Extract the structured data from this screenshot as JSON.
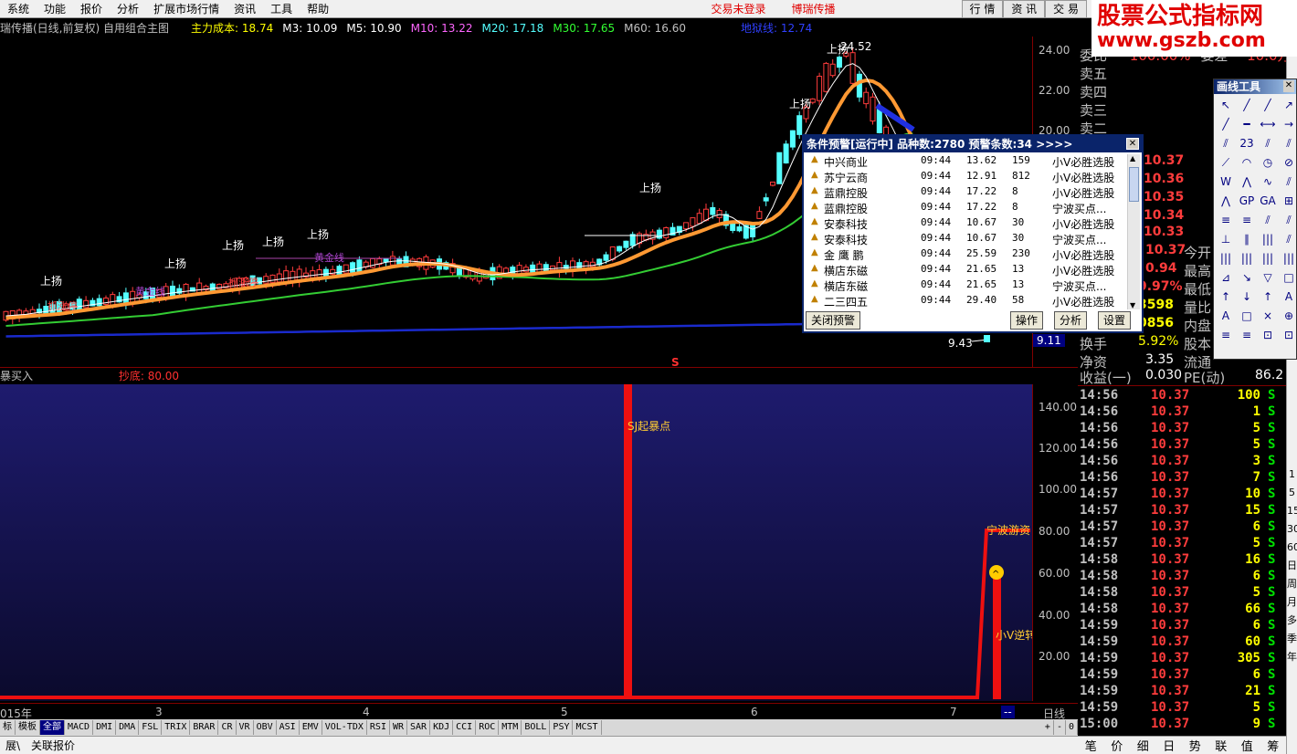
{
  "menu": {
    "items": [
      "系统",
      "功能",
      "报价",
      "分析",
      "扩展市场行情",
      "资讯",
      "工具",
      "帮助"
    ],
    "status_warn": "交易未登录",
    "status_brand": "博瑞传播",
    "right_tabs": [
      "行 情",
      "资 讯",
      "交 易"
    ]
  },
  "watermark": {
    "line1": "股票公式指标网",
    "line2": "www.gszb.com"
  },
  "chart_header": {
    "title": "瑞传播(日线,前复权) 自用组合主图",
    "main_cost": "主力成本: 18.74",
    "m3": "M3: 10.09",
    "m5": "M5: 10.90",
    "m10": "M10: 13.22",
    "m20": "M20: 17.18",
    "m30": "M30: 17.65",
    "m60": "M60: 16.60",
    "extra": "地狱线: 12.74"
  },
  "price_axis": [
    "24.00",
    "22.00",
    "20.00"
  ],
  "chart_labels": {
    "high_label": "24.52",
    "low_label": "9.43",
    "up_tag": "上扬",
    "catch_limit": "抓涨停",
    "gold_line": "黄金线",
    "s_marker": "S",
    "low_current": "9.11"
  },
  "indicator": {
    "name": "暴买入",
    "bottom_label": "抄底: 80.00",
    "axis": [
      "140.00",
      "120.00",
      "100.00",
      "80.00",
      "60.00",
      "40.00",
      "20.00"
    ],
    "sj_label": "SJ起暴点",
    "nb_label": "宁波游资",
    "xv_label": "小V逆转"
  },
  "date_axis": {
    "labels": [
      "015年",
      "3",
      "4",
      "5",
      "6",
      "7"
    ],
    "end_marker": "--",
    "period": "日线"
  },
  "indicator_tabs": [
    "标",
    "模板",
    "全部",
    "MACD",
    "DMI",
    "DMA",
    "FSL",
    "TRIX",
    "BRAR",
    "CR",
    "VR",
    "OBV",
    "ASI",
    "EMV",
    "VOL-TDX",
    "RSI",
    "WR",
    "SAR",
    "KDJ",
    "CCI",
    "ROC",
    "MTM",
    "BOLL",
    "PSY",
    "MCST"
  ],
  "tab_controls": [
    "+",
    "-",
    "0"
  ],
  "status_bar": [
    "展\\",
    "关联报价"
  ],
  "quote_panel": {
    "top": {
      "label": "委比",
      "value": "100.00%",
      "label2": "委差",
      "value2": "10.0万"
    },
    "sell_labels": [
      "卖五",
      "卖四",
      "卖三",
      "卖二"
    ],
    "price_col": [
      "10.37",
      "10.36",
      "10.35",
      "10.34",
      "10.33"
    ],
    "rows": [
      {
        "label": "",
        "value": "10.37",
        "label2": "今开",
        "value2": ""
      },
      {
        "label": "",
        "value": "0.94",
        "label2": "最高",
        "value2": ""
      },
      {
        "label": "",
        "value": "9.97%",
        "label2": "最低",
        "value2": ""
      },
      {
        "label": "",
        "value": "3598",
        "label2": "量比",
        "value2": ""
      },
      {
        "label": "",
        "value": "0856",
        "label2": "内盘",
        "value2": ""
      },
      {
        "label": "换手",
        "value": "5.92%",
        "label2": "股本",
        "value2": ""
      },
      {
        "label": "净资",
        "value": "3.35",
        "label2": "流通",
        "value2": ""
      },
      {
        "label": "收益(一)",
        "value": "0.030",
        "label2": "PE(动)",
        "value2": "86.2"
      }
    ]
  },
  "ticks": [
    {
      "time": "14:56",
      "price": "10.37",
      "vol": "100",
      "side": "S"
    },
    {
      "time": "14:56",
      "price": "10.37",
      "vol": "1",
      "side": "S"
    },
    {
      "time": "14:56",
      "price": "10.37",
      "vol": "5",
      "side": "S"
    },
    {
      "time": "14:56",
      "price": "10.37",
      "vol": "5",
      "side": "S"
    },
    {
      "time": "14:56",
      "price": "10.37",
      "vol": "3",
      "side": "S"
    },
    {
      "time": "14:56",
      "price": "10.37",
      "vol": "7",
      "side": "S"
    },
    {
      "time": "14:57",
      "price": "10.37",
      "vol": "10",
      "side": "S"
    },
    {
      "time": "14:57",
      "price": "10.37",
      "vol": "15",
      "side": "S"
    },
    {
      "time": "14:57",
      "price": "10.37",
      "vol": "6",
      "side": "S"
    },
    {
      "time": "14:57",
      "price": "10.37",
      "vol": "5",
      "side": "S"
    },
    {
      "time": "14:58",
      "price": "10.37",
      "vol": "16",
      "side": "S"
    },
    {
      "time": "14:58",
      "price": "10.37",
      "vol": "6",
      "side": "S"
    },
    {
      "time": "14:58",
      "price": "10.37",
      "vol": "5",
      "side": "S"
    },
    {
      "time": "14:58",
      "price": "10.37",
      "vol": "66",
      "side": "S"
    },
    {
      "time": "14:59",
      "price": "10.37",
      "vol": "6",
      "side": "S"
    },
    {
      "time": "14:59",
      "price": "10.37",
      "vol": "60",
      "side": "S"
    },
    {
      "time": "14:59",
      "price": "10.37",
      "vol": "305",
      "side": "S"
    },
    {
      "time": "14:59",
      "price": "10.37",
      "vol": "6",
      "side": "S"
    },
    {
      "time": "14:59",
      "price": "10.37",
      "vol": "21",
      "side": "S"
    },
    {
      "time": "14:59",
      "price": "10.37",
      "vol": "5",
      "side": "S"
    },
    {
      "time": "15:00",
      "price": "10.37",
      "vol": "9",
      "side": "S"
    }
  ],
  "bottom_tabs": [
    "笔",
    "价",
    "细",
    "日",
    "势",
    "联",
    "值",
    "筹"
  ],
  "side_strip": [
    "1",
    "5",
    "15",
    "30",
    "60",
    "日",
    "周",
    "月",
    "多",
    "季",
    "年"
  ],
  "draw_tools": {
    "title": "画线工具",
    "icons": [
      "↖",
      "╱",
      "╱",
      "↗",
      "╱",
      "━",
      "⟷",
      "→",
      "⫽",
      "23",
      "⫽",
      "⫽",
      "⟋",
      "◠",
      "◷",
      "⊘",
      "W",
      "⋀",
      "∿",
      "⫽",
      "⋀",
      "GP",
      "GA",
      "⊞",
      "≡",
      "≡",
      "⫽",
      "⫽",
      "⊥",
      "∥",
      "|||",
      "⫽",
      "|||",
      "|||",
      "|||",
      "|||",
      "⊿",
      "↘",
      "▽",
      "□",
      "↑",
      "↓",
      "↑",
      "A",
      "Ａ",
      "□",
      "×",
      "⊕",
      "≡",
      "≡",
      "⊡",
      "⊡"
    ]
  },
  "alert": {
    "title": "条件预警[运行中] 品种数:2780 预警条数:34 >>>>",
    "rows": [
      {
        "name": "中兴商业",
        "time": "09:44",
        "price": "13.62",
        "qty": "159",
        "type": "小V必胜选股"
      },
      {
        "name": "苏宁云商",
        "time": "09:44",
        "price": "12.91",
        "qty": "812",
        "type": "小V必胜选股"
      },
      {
        "name": "蓝鼎控股",
        "time": "09:44",
        "price": "17.22",
        "qty": "8",
        "type": "小V必胜选股"
      },
      {
        "name": "蓝鼎控股",
        "time": "09:44",
        "price": "17.22",
        "qty": "8",
        "type": "宁波买点..."
      },
      {
        "name": "安泰科技",
        "time": "09:44",
        "price": "10.67",
        "qty": "30",
        "type": "小V必胜选股"
      },
      {
        "name": "安泰科技",
        "time": "09:44",
        "price": "10.67",
        "qty": "30",
        "type": "宁波买点..."
      },
      {
        "name": "金 鹰 鹏",
        "time": "09:44",
        "price": "25.59",
        "qty": "230",
        "type": "小V必胜选股"
      },
      {
        "name": "横店东磁",
        "time": "09:44",
        "price": "21.65",
        "qty": "13",
        "type": "小V必胜选股"
      },
      {
        "name": "横店东磁",
        "time": "09:44",
        "price": "21.65",
        "qty": "13",
        "type": "宁波买点..."
      },
      {
        "name": "二三四五",
        "time": "09:44",
        "price": "29.40",
        "qty": "58",
        "type": "小V必胜选股"
      }
    ],
    "btn_close": "关闭预警",
    "btn_op": "操作",
    "btn_an": "分析",
    "btn_set": "设置"
  },
  "colors": {
    "up": "#ff3c3c",
    "down": "#54ffff",
    "ma_orange": "#ff9933",
    "ma_green": "#33cc33",
    "ma_blue": "#1a2acc",
    "axis_red": "#800000"
  }
}
